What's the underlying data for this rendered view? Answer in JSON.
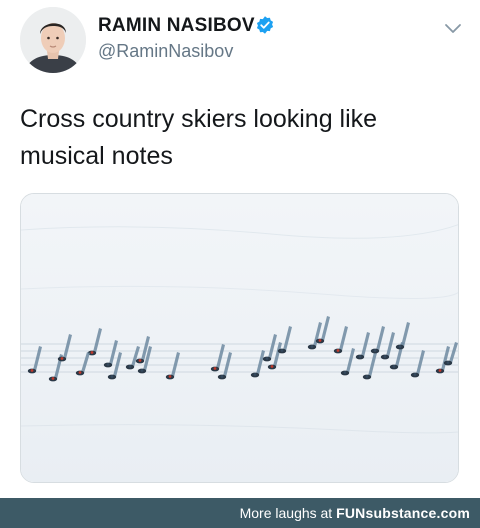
{
  "tweet": {
    "display_name": "RAMIN NASIBOV",
    "handle": "@RaminNasibov",
    "verified": true,
    "text_line1": "Cross country skiers looking like",
    "text_line2": "musical notes",
    "avatar_icon": "user-avatar",
    "verified_icon": "verified-badge-icon",
    "menu_icon": "chevron-down-icon"
  },
  "media": {
    "icon": "photo",
    "skier_count": 30
  },
  "footer": {
    "prefix": "More laughs at ",
    "brand": "FUNsubstance.com",
    "bar_color": "#3d5a66"
  },
  "colors": {
    "verified_blue": "#1da1f2",
    "name": "#14171a",
    "handle": "#657786"
  }
}
